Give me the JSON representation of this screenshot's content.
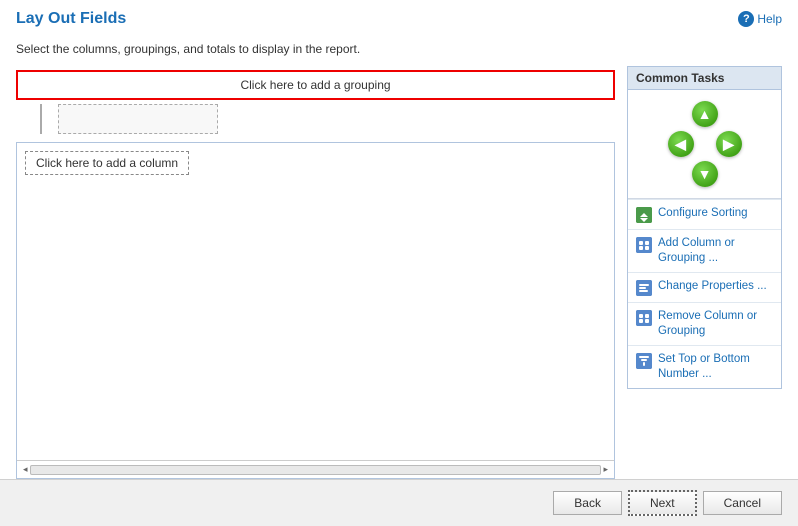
{
  "header": {
    "title": "Lay Out Fields",
    "help_label": "Help"
  },
  "subtitle": "Select the columns, groupings, and totals to display in the report.",
  "layout": {
    "add_grouping_label": "Click here to add a grouping",
    "add_column_label": "Click here to add a column"
  },
  "common_tasks": {
    "title": "Common Tasks",
    "items": [
      {
        "id": "configure-sorting",
        "label": "Configure Sorting",
        "icon": "sort-icon"
      },
      {
        "id": "add-column-grouping",
        "label": "Add Column or\nGrouping ...",
        "icon": "add-icon"
      },
      {
        "id": "change-properties",
        "label": "Change Properties ...",
        "icon": "change-icon"
      },
      {
        "id": "remove-column-grouping",
        "label": "Remove Column or\nGrouping",
        "icon": "remove-icon"
      },
      {
        "id": "set-top-bottom",
        "label": "Set Top or Bottom\nNumber ...",
        "icon": "top-icon"
      }
    ]
  },
  "footer": {
    "back_label": "Back",
    "next_label": "Next",
    "cancel_label": "Cancel"
  },
  "arrows": {
    "up": "▲",
    "down": "▼",
    "left": "◀",
    "right": "▶"
  }
}
